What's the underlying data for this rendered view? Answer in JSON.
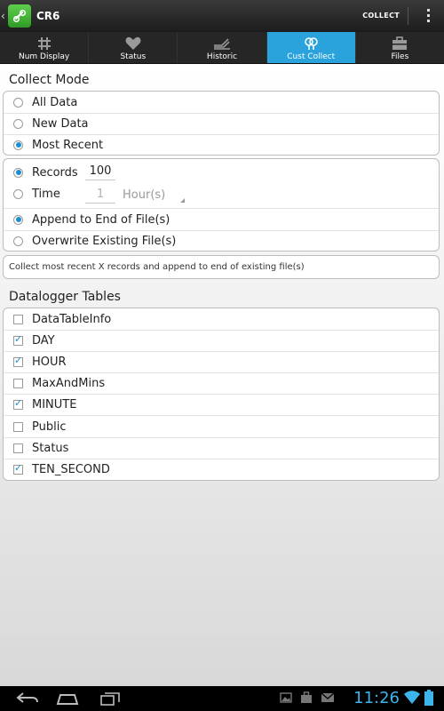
{
  "app": {
    "title": "CR6"
  },
  "actionbar": {
    "collect_label": "COLLECT"
  },
  "tabs": [
    {
      "label": "Num Display",
      "icon": "grid-icon"
    },
    {
      "label": "Status",
      "icon": "heart-icon"
    },
    {
      "label": "Historic",
      "icon": "graph-icon"
    },
    {
      "label": "Cust Collect",
      "icon": "connect-icon",
      "active": true
    },
    {
      "label": "Files",
      "icon": "briefcase-icon"
    }
  ],
  "collect_mode": {
    "title": "Collect Mode",
    "options": [
      {
        "label": "All Data",
        "selected": false
      },
      {
        "label": "New Data",
        "selected": false
      },
      {
        "label": "Most Recent",
        "selected": true
      }
    ]
  },
  "records": {
    "records_label": "Records",
    "records_value": "100",
    "records_selected": true,
    "time_label": "Time",
    "time_value": "1",
    "time_unit": "Hour(s)",
    "time_selected": false,
    "append_label": "Append to End of File(s)",
    "append_selected": true,
    "overwrite_label": "Overwrite Existing File(s)",
    "overwrite_selected": false
  },
  "description": "Collect most recent X records and append to end of existing file(s)",
  "tables": {
    "title": "Datalogger Tables",
    "items": [
      {
        "label": "DataTableInfo",
        "checked": false
      },
      {
        "label": "DAY",
        "checked": true
      },
      {
        "label": "HOUR",
        "checked": true
      },
      {
        "label": "MaxAndMins",
        "checked": false
      },
      {
        "label": "MINUTE",
        "checked": true
      },
      {
        "label": "Public",
        "checked": false
      },
      {
        "label": "Status",
        "checked": false
      },
      {
        "label": "TEN_SECOND",
        "checked": true
      }
    ]
  },
  "statusbar": {
    "clock": "11:26"
  },
  "colors": {
    "accent": "#2aa3dd",
    "check": "#1a8fd0",
    "clock": "#3bb5ec"
  }
}
